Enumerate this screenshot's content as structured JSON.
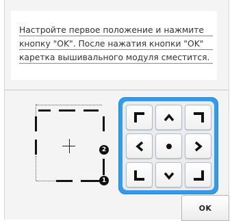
{
  "message": {
    "lines": [
      "Настройте первое положение и нажмите",
      "кнопку \"OK\". После нажатия кнопки \"OK\"",
      "каретка вышивального модуля сместится."
    ]
  },
  "diagram": {
    "badge_1": "1",
    "badge_2": "2"
  },
  "pad": {
    "accent_color": "#2f9bf2",
    "keys": [
      "corner-top-left-icon",
      "arrow-up-icon",
      "corner-top-right-icon",
      "arrow-left-icon",
      "center-dot-icon",
      "arrow-right-icon",
      "corner-bottom-left-icon",
      "arrow-down-icon",
      "corner-bottom-right-icon"
    ]
  },
  "ok_button": {
    "label": "OK"
  }
}
